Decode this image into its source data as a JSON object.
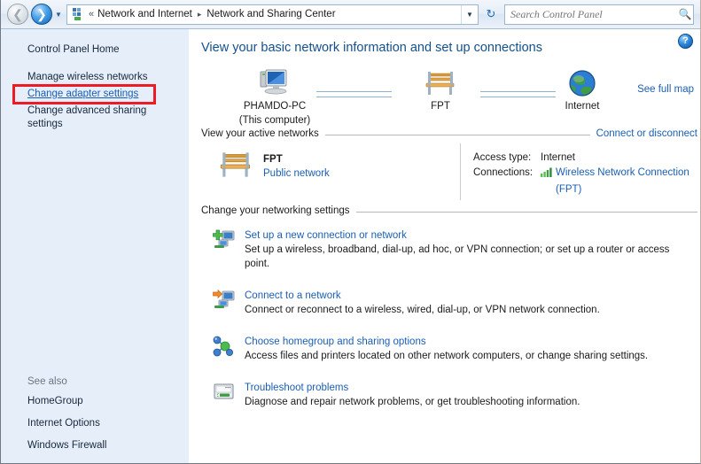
{
  "window": {
    "addressbar": {
      "back_icon": "back-arrow-icon",
      "forward_icon": "forward-arrow-icon",
      "history_icon": "chevron-down-icon",
      "breadcrumb_icon": "network-icon",
      "overflow_chevrons": "«",
      "crumbs": [
        "Network and Internet",
        "Network and Sharing Center"
      ],
      "separator": "▸",
      "dropdown_icon": "chevron-down-icon",
      "refresh_icon": "refresh-icon",
      "refresh_glyph": "↻"
    },
    "search": {
      "placeholder": "Search Control Panel",
      "value": "",
      "icon": "search-icon"
    }
  },
  "sidebar": {
    "home_label": "Control Panel Home",
    "items": [
      {
        "label": "Manage wireless networks",
        "link": false
      },
      {
        "label": "Change adapter settings",
        "link": true
      },
      {
        "label": "Change advanced sharing settings",
        "link": false
      }
    ],
    "see_also_heading": "See also",
    "see_also": [
      {
        "label": "HomeGroup"
      },
      {
        "label": "Internet Options"
      },
      {
        "label": "Windows Firewall"
      }
    ],
    "annotation": {
      "target": "Change adapter settings",
      "color": "#ed1c24"
    }
  },
  "content": {
    "help_icon": "help-icon",
    "help_glyph": "?",
    "title": "View your basic network information and set up connections",
    "network_map": {
      "nodes": [
        {
          "label_primary": "PHAMDO-PC",
          "label_secondary": "(This computer)",
          "icon": "computer-icon"
        },
        {
          "label_primary": "FPT",
          "label_secondary": "",
          "icon": "bench-network-icon"
        },
        {
          "label_primary": "Internet",
          "label_secondary": "",
          "icon": "globe-icon"
        }
      ],
      "see_full_map": "See full map"
    },
    "active_networks": {
      "heading": "View your active networks",
      "action": "Connect or disconnect",
      "network_name": "FPT",
      "network_type": "Public network",
      "network_icon": "bench-network-icon",
      "access_type_key": "Access type:",
      "access_type_value": "Internet",
      "connections_key": "Connections:",
      "connections_icon": "wireless-signal-icon",
      "connections_value_line1": "Wireless Network Connection",
      "connections_value_line2": "(FPT)"
    },
    "networking_settings": {
      "heading": "Change your networking settings",
      "items": [
        {
          "icon": "add-connection-icon",
          "title": "Set up a new connection or network",
          "desc": "Set up a wireless, broadband, dial-up, ad hoc, or VPN connection; or set up a router or access point."
        },
        {
          "icon": "connect-network-icon",
          "title": "Connect to a network",
          "desc": "Connect or reconnect to a wireless, wired, dial-up, or VPN network connection."
        },
        {
          "icon": "homegroup-icon",
          "title": "Choose homegroup and sharing options",
          "desc": "Access files and printers located on other network computers, or change sharing settings."
        },
        {
          "icon": "troubleshoot-icon",
          "title": "Troubleshoot problems",
          "desc": "Diagnose and repair network problems, or get troubleshooting information."
        }
      ]
    }
  },
  "colors": {
    "link": "#1a5fb4",
    "title": "#14508c",
    "sidebar_bg": "#e6eefa",
    "annotation": "#ed1c24"
  }
}
